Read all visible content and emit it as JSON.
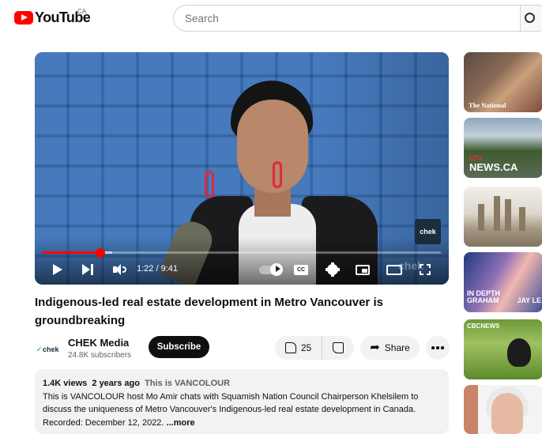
{
  "header": {
    "logo_text": "YouTube",
    "country": "CA",
    "search_placeholder": "Search"
  },
  "player": {
    "time_current": "1:22",
    "time_total": "9:41",
    "time_display": "1:22 / 9:41",
    "progress_played": 0.145,
    "progress_loaded": 0.175,
    "bug_text": "chek",
    "watermark": "chek",
    "cc_label": "CC"
  },
  "video": {
    "title": "Indigenous-led real estate development in Metro Vancouver is groundbreaking"
  },
  "channel": {
    "avatar_text": "chek",
    "name": "CHEK Media",
    "subscribers": "24.8K subscribers",
    "subscribe_label": "Subscribe"
  },
  "actions": {
    "likes": "25",
    "share_label": "Share"
  },
  "description": {
    "views": "1.4K views",
    "age": "2 years ago",
    "tag": "This is VANCOLOUR",
    "text": "This is VANCOLOUR host Mo Amir chats with Squamish Nation Council Chairperson Khelsilem to discuss the uniqueness of Metro Vancouver's Indigenous-led real estate development in Canada. Recorded: December 12, 2022.",
    "more_label": "...more"
  },
  "sidebar": {
    "thumbs": [
      {
        "caption": "The National"
      },
      {
        "caption": "NEWS.CA",
        "caption_small": "CTV"
      },
      {
        "caption": ""
      },
      {
        "caption_line1": "IN DEPTH",
        "caption_line2": "GRAHAM",
        "caption_right": "JAY LE"
      },
      {
        "caption": "CBCNEWS"
      },
      {
        "caption": ""
      }
    ]
  },
  "colors": {
    "brand_red": "#ff0000",
    "subscribe_bg": "#0f0f0f",
    "pill_bg": "#f2f2f2"
  }
}
